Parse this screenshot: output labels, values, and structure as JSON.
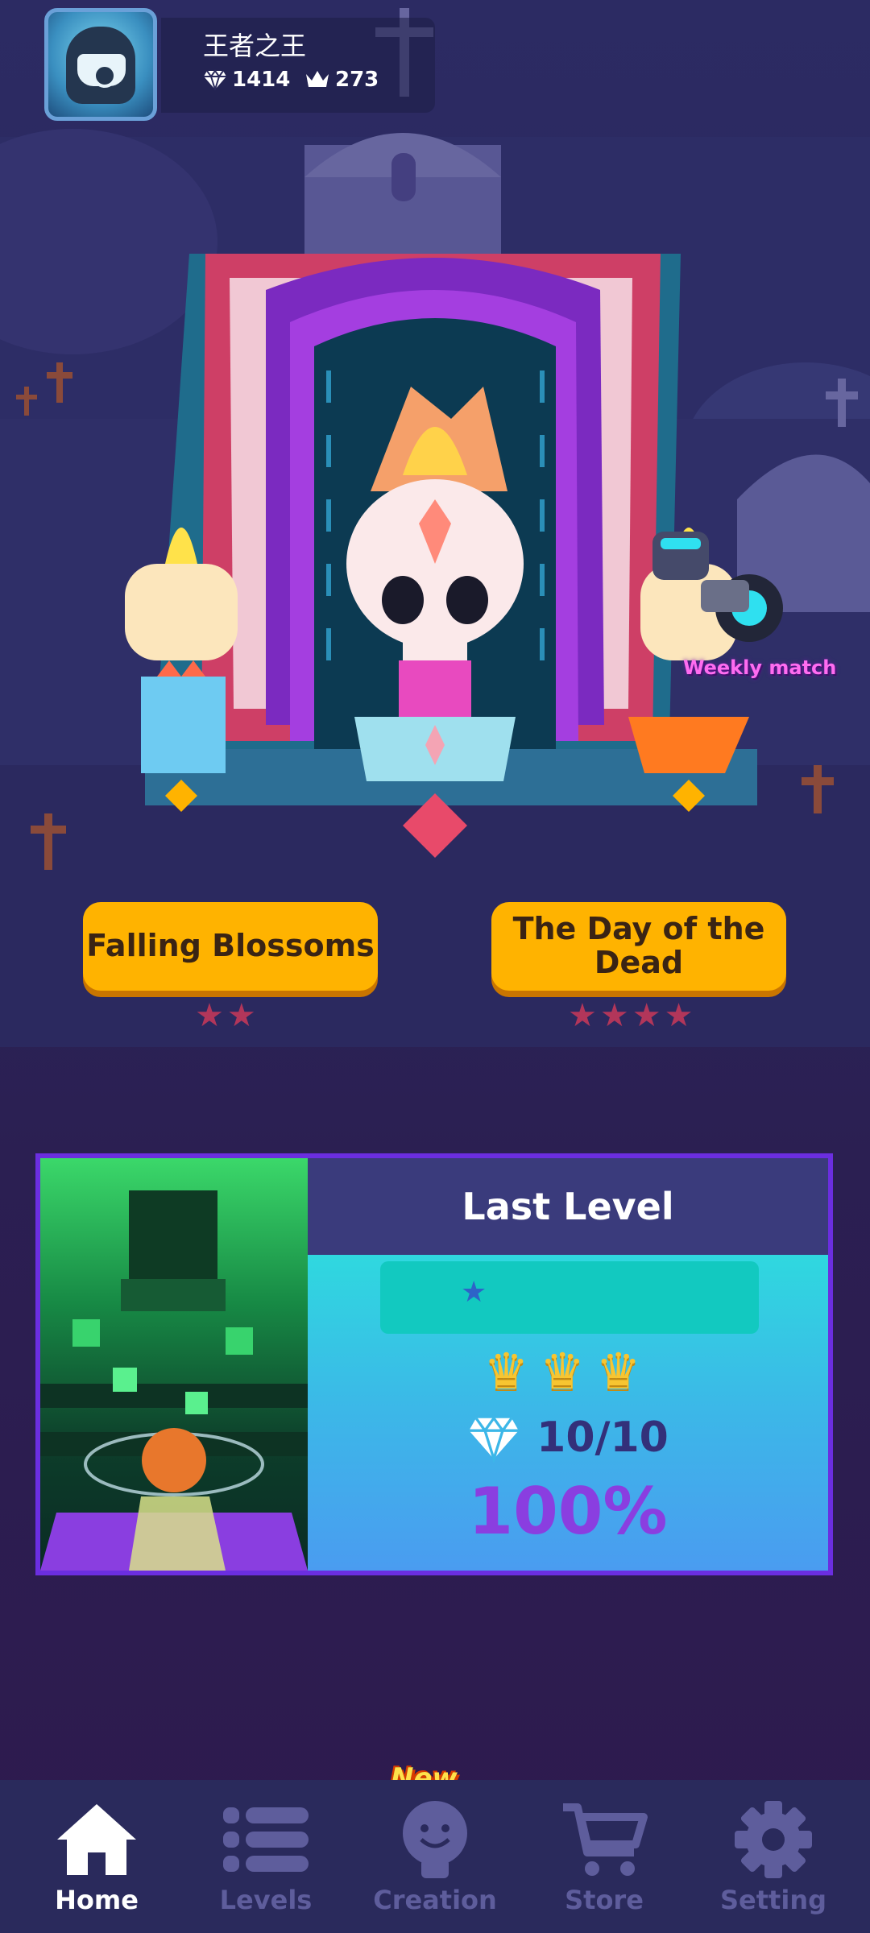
{
  "player": {
    "name": "王者之王",
    "diamonds": "1414",
    "crowns": "273"
  },
  "levels": {
    "left": {
      "title": "Falling Blossoms",
      "stars": "★★"
    },
    "right": {
      "title": "The Day of the Dead",
      "stars": "★★★★"
    }
  },
  "weekly_match": "Weekly match",
  "last_level": {
    "title": "Last Level",
    "progress_star": "★",
    "crowns": "♛♛♛",
    "gems": "10/10",
    "percent": "100%"
  },
  "nav": {
    "new_badge": "New",
    "items": [
      {
        "label": "Home",
        "icon": "home-icon",
        "active": true
      },
      {
        "label": "Levels",
        "icon": "list-icon",
        "active": false
      },
      {
        "label": "Creation",
        "icon": "lightbulb-icon",
        "active": false
      },
      {
        "label": "Store",
        "icon": "cart-icon",
        "active": false
      },
      {
        "label": "Setting",
        "icon": "gear-icon",
        "active": false
      }
    ]
  },
  "colors": {
    "button": "#ffb300",
    "card_border": "#6b2ee0",
    "percent": "#8a3ee0",
    "nav_active": "#ffffff",
    "nav_inactive": "#5e5d9c"
  }
}
